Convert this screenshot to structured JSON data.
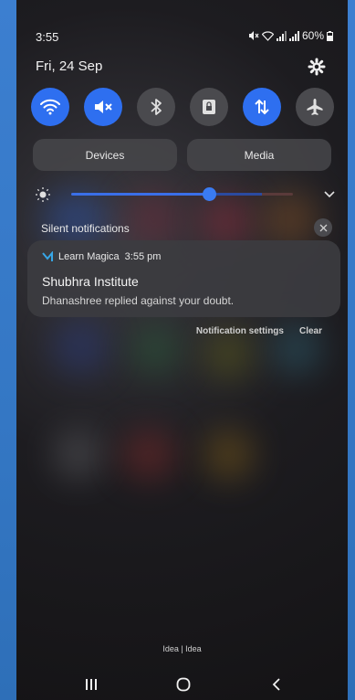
{
  "status_bar": {
    "time": "3:55",
    "battery": "60%",
    "icons": [
      "mute-icon",
      "wifi-icon",
      "signal-icon",
      "signal-icon",
      "battery-icon"
    ]
  },
  "quick_panel": {
    "date": "Fri, 24 Sep",
    "settings_icon": "gear-icon",
    "toggles": [
      {
        "name": "wifi",
        "icon": "wifi-icon",
        "on": true
      },
      {
        "name": "sound",
        "icon": "mute-icon",
        "on": true
      },
      {
        "name": "bluetooth",
        "icon": "bluetooth-icon",
        "on": false
      },
      {
        "name": "portrait-lock",
        "icon": "portrait-lock-icon",
        "on": false
      },
      {
        "name": "mobile-data",
        "icon": "data-arrows-icon",
        "on": true
      },
      {
        "name": "airplane",
        "icon": "airplane-icon",
        "on": false
      }
    ],
    "devices_label": "Devices",
    "media_label": "Media",
    "brightness_level": 0.62
  },
  "notifications": {
    "section_label": "Silent notifications",
    "items": [
      {
        "app_name": "Learn Magica",
        "time": "3:55 pm",
        "title": "Shubhra Institute",
        "body": "Dhanashree replied against your doubt."
      }
    ],
    "settings_label": "Notification settings",
    "clear_label": "Clear"
  },
  "footer": {
    "carrier": "Idea | Idea"
  },
  "colors": {
    "accent": "#2e6ff0",
    "background": "#1d1c20"
  }
}
